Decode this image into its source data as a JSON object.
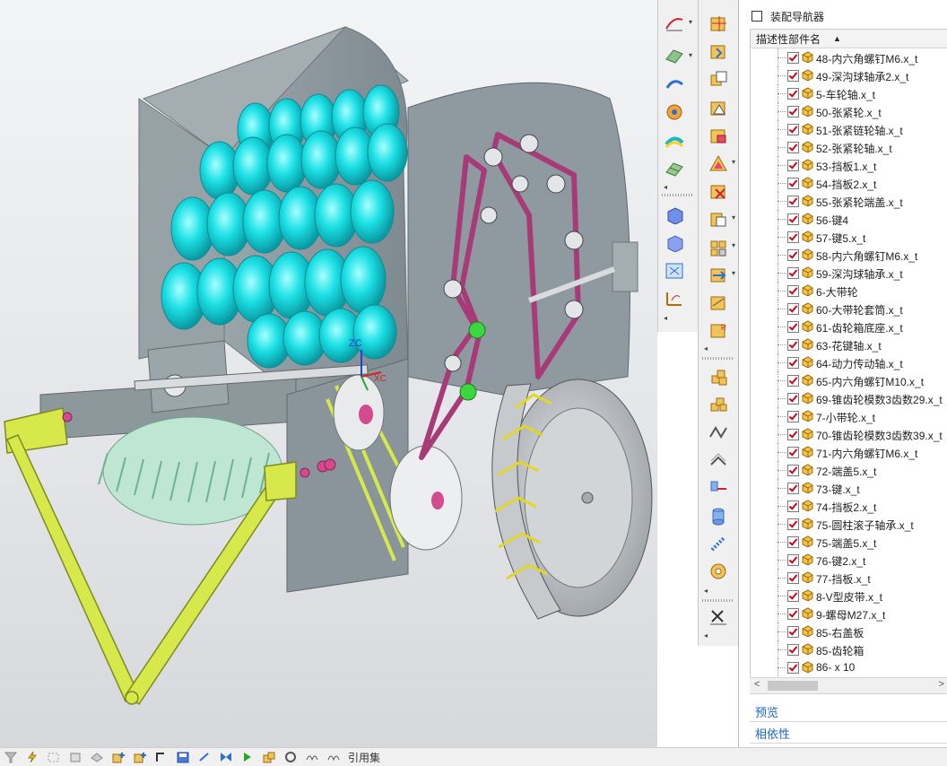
{
  "navigator": {
    "title": "装配导航器",
    "column_header": "描述性部件名",
    "sort_indicator": "▲",
    "items": [
      "48-内六角螺钉M6.x_t",
      "49-深沟球轴承2.x_t",
      "5-车轮轴.x_t",
      "50-张紧轮.x_t",
      "51-张紧链轮轴.x_t",
      "52-张紧轮轴.x_t",
      "53-挡板1.x_t",
      "54-挡板2.x_t",
      "55-张紧轮端盖.x_t",
      "56-键4",
      "57-键5.x_t",
      "58-内六角螺钉M6.x_t",
      "59-深沟球轴承.x_t",
      "6-大带轮",
      "60-大带轮套筒.x_t",
      "61-齿轮箱底座.x_t",
      "63-花键轴.x_t",
      "64-动力传动轴.x_t",
      "65-内六角螺钉M10.x_t",
      "69-锥齿轮模数3齿数29.x_t",
      "7-小带轮.x_t",
      "70-锥齿轮模数3齿数39.x_t",
      "71-内六角螺钉M6.x_t",
      "72-端盖5.x_t",
      "73-键.x_t",
      "74-挡板2.x_t",
      "75-圆柱滚子轴承.x_t",
      "75-端盖5.x_t",
      "76-键2.x_t",
      "77-挡板.x_t",
      "8-V型皮带.x_t",
      "9-螺母M27.x_t",
      "85-右盖板",
      "85-齿轮箱",
      "86- x 10"
    ],
    "scroll_left": "<",
    "scroll_right": ">",
    "sections": {
      "preview": "预览",
      "dependencies": "相依性"
    }
  },
  "viewport": {
    "axis_labels": {
      "z": "ZC",
      "x": "XC"
    },
    "colors": {
      "body": "#8c989d",
      "roller": "#19e3e6",
      "chain": "#a83a78",
      "belt": "#d7e84a",
      "wheel": "#bfc4c8"
    }
  },
  "status_bar": {
    "label": "引用集"
  },
  "toolbar_icons": {
    "col1": [
      "curve-sketch-icon",
      "surface-icon",
      "sweep-icon",
      "analysis-icon",
      "face-curvature-icon",
      "mesh-icon",
      "view-solid-icon",
      "view-shaded-icon",
      "fit-view-icon",
      "measure-icon"
    ],
    "col2": [
      "assembly-move-icon",
      "add-component-icon",
      "new-parent-icon",
      "mirror-assembly-icon",
      "constraint-icon",
      "explode-icon",
      "remove-icon",
      "clone-icon",
      "pattern-icon",
      "replace-icon",
      "wave-link-icon",
      "create-component-icon",
      "parts-list-icon",
      "gear-icon",
      "pulley-icon",
      "spring-icon",
      "bolt-icon",
      "bearing-icon",
      "damper-icon",
      "rope-icon",
      "delete-icon"
    ]
  }
}
